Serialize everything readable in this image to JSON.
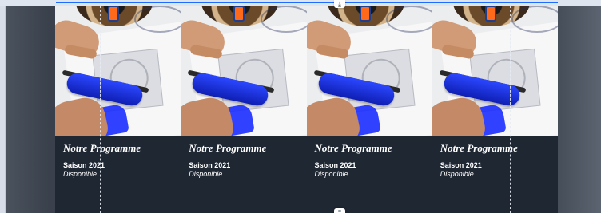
{
  "editor": {
    "top_handle_icon": "download-icon",
    "bottom_handle_icon": "drag-handle-icon"
  },
  "cards": [
    {
      "title": "Notre Programme",
      "season": "Saison 2021",
      "status": "Disponible",
      "image": "printmaking-blue-roller-image"
    },
    {
      "title": "Notre Programme",
      "season": "Saison 2021",
      "status": "Disponible",
      "image": "printmaking-blue-roller-image"
    },
    {
      "title": "Notre Programme",
      "season": "Saison 2021",
      "status": "Disponible",
      "image": "printmaking-blue-roller-image"
    },
    {
      "title": "Notre Programme",
      "season": "Saison 2021",
      "status": "Disponible",
      "image": "printmaking-blue-roller-image"
    }
  ],
  "colors": {
    "section_background": "#1f2733",
    "selection_blue": "#1e6bff",
    "ink_blue": "#1a2cff"
  }
}
